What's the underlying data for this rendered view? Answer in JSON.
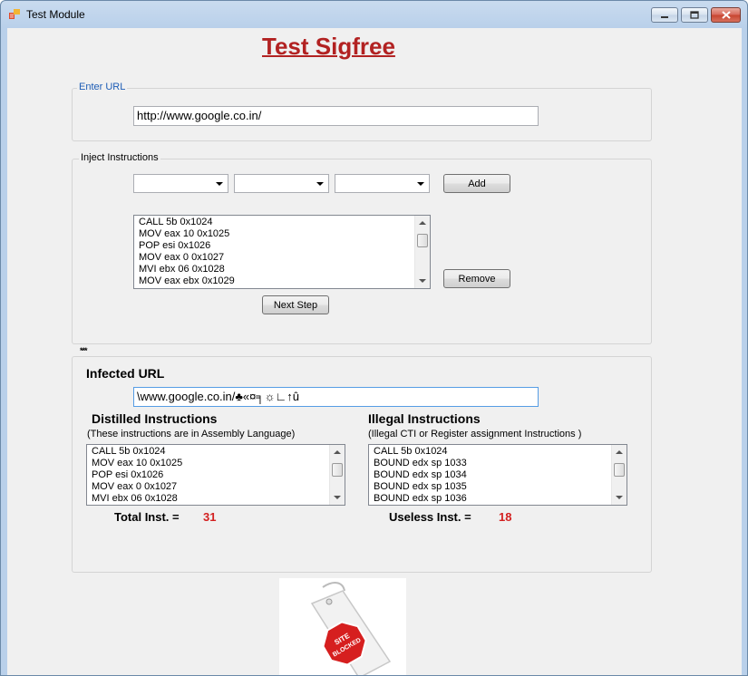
{
  "window": {
    "title": "Test Module"
  },
  "heading": "Test Sigfree",
  "url_group": {
    "label": "Enter URL",
    "value": "http://www.google.co.in/"
  },
  "inject_group": {
    "label": "Inject Instructions",
    "combo1": "",
    "combo2": "",
    "combo3": "",
    "add_label": "Add",
    "remove_label": "Remove",
    "next_label": "Next Step",
    "instructions": [
      "CALL 5b 0x1024",
      "MOV eax 10 0x1025",
      "POP esi 0x1026",
      "MOV eax 0 0x1027",
      "MVI  ebx 06 0x1028",
      "MOV  eax ebx 0x1029"
    ]
  },
  "separator_mark": "***",
  "result_group": {
    "infected_label": "Infected URL",
    "infected_value": "\\www.google.co.in/♣«¤╕☼∟↑û",
    "distilled_title": "Distilled Instructions",
    "distilled_note": "(These instructions are in Assembly Language)",
    "distilled_items": [
      "CALL 5b 0x1024",
      "MOV eax 10 0x1025",
      "POP esi 0x1026",
      "MOV eax 0 0x1027",
      "MVI  ebx 06 0x1028"
    ],
    "illegal_title": "Illegal Instructions",
    "illegal_note": "(Illegal CTI or Register assignment Instructions )",
    "illegal_items": [
      "CALL 5b 0x1024",
      "BOUND edx sp 1033",
      "BOUND edx sp 1034",
      "BOUND edx sp 1035",
      "BOUND edx sp 1036"
    ],
    "total_label": "Total Inst.  =",
    "total_value": "31",
    "useless_label": "Useless Inst.  =",
    "useless_value": "18"
  },
  "stamp": {
    "line1": "SITE",
    "line2": "BLOCKED"
  }
}
